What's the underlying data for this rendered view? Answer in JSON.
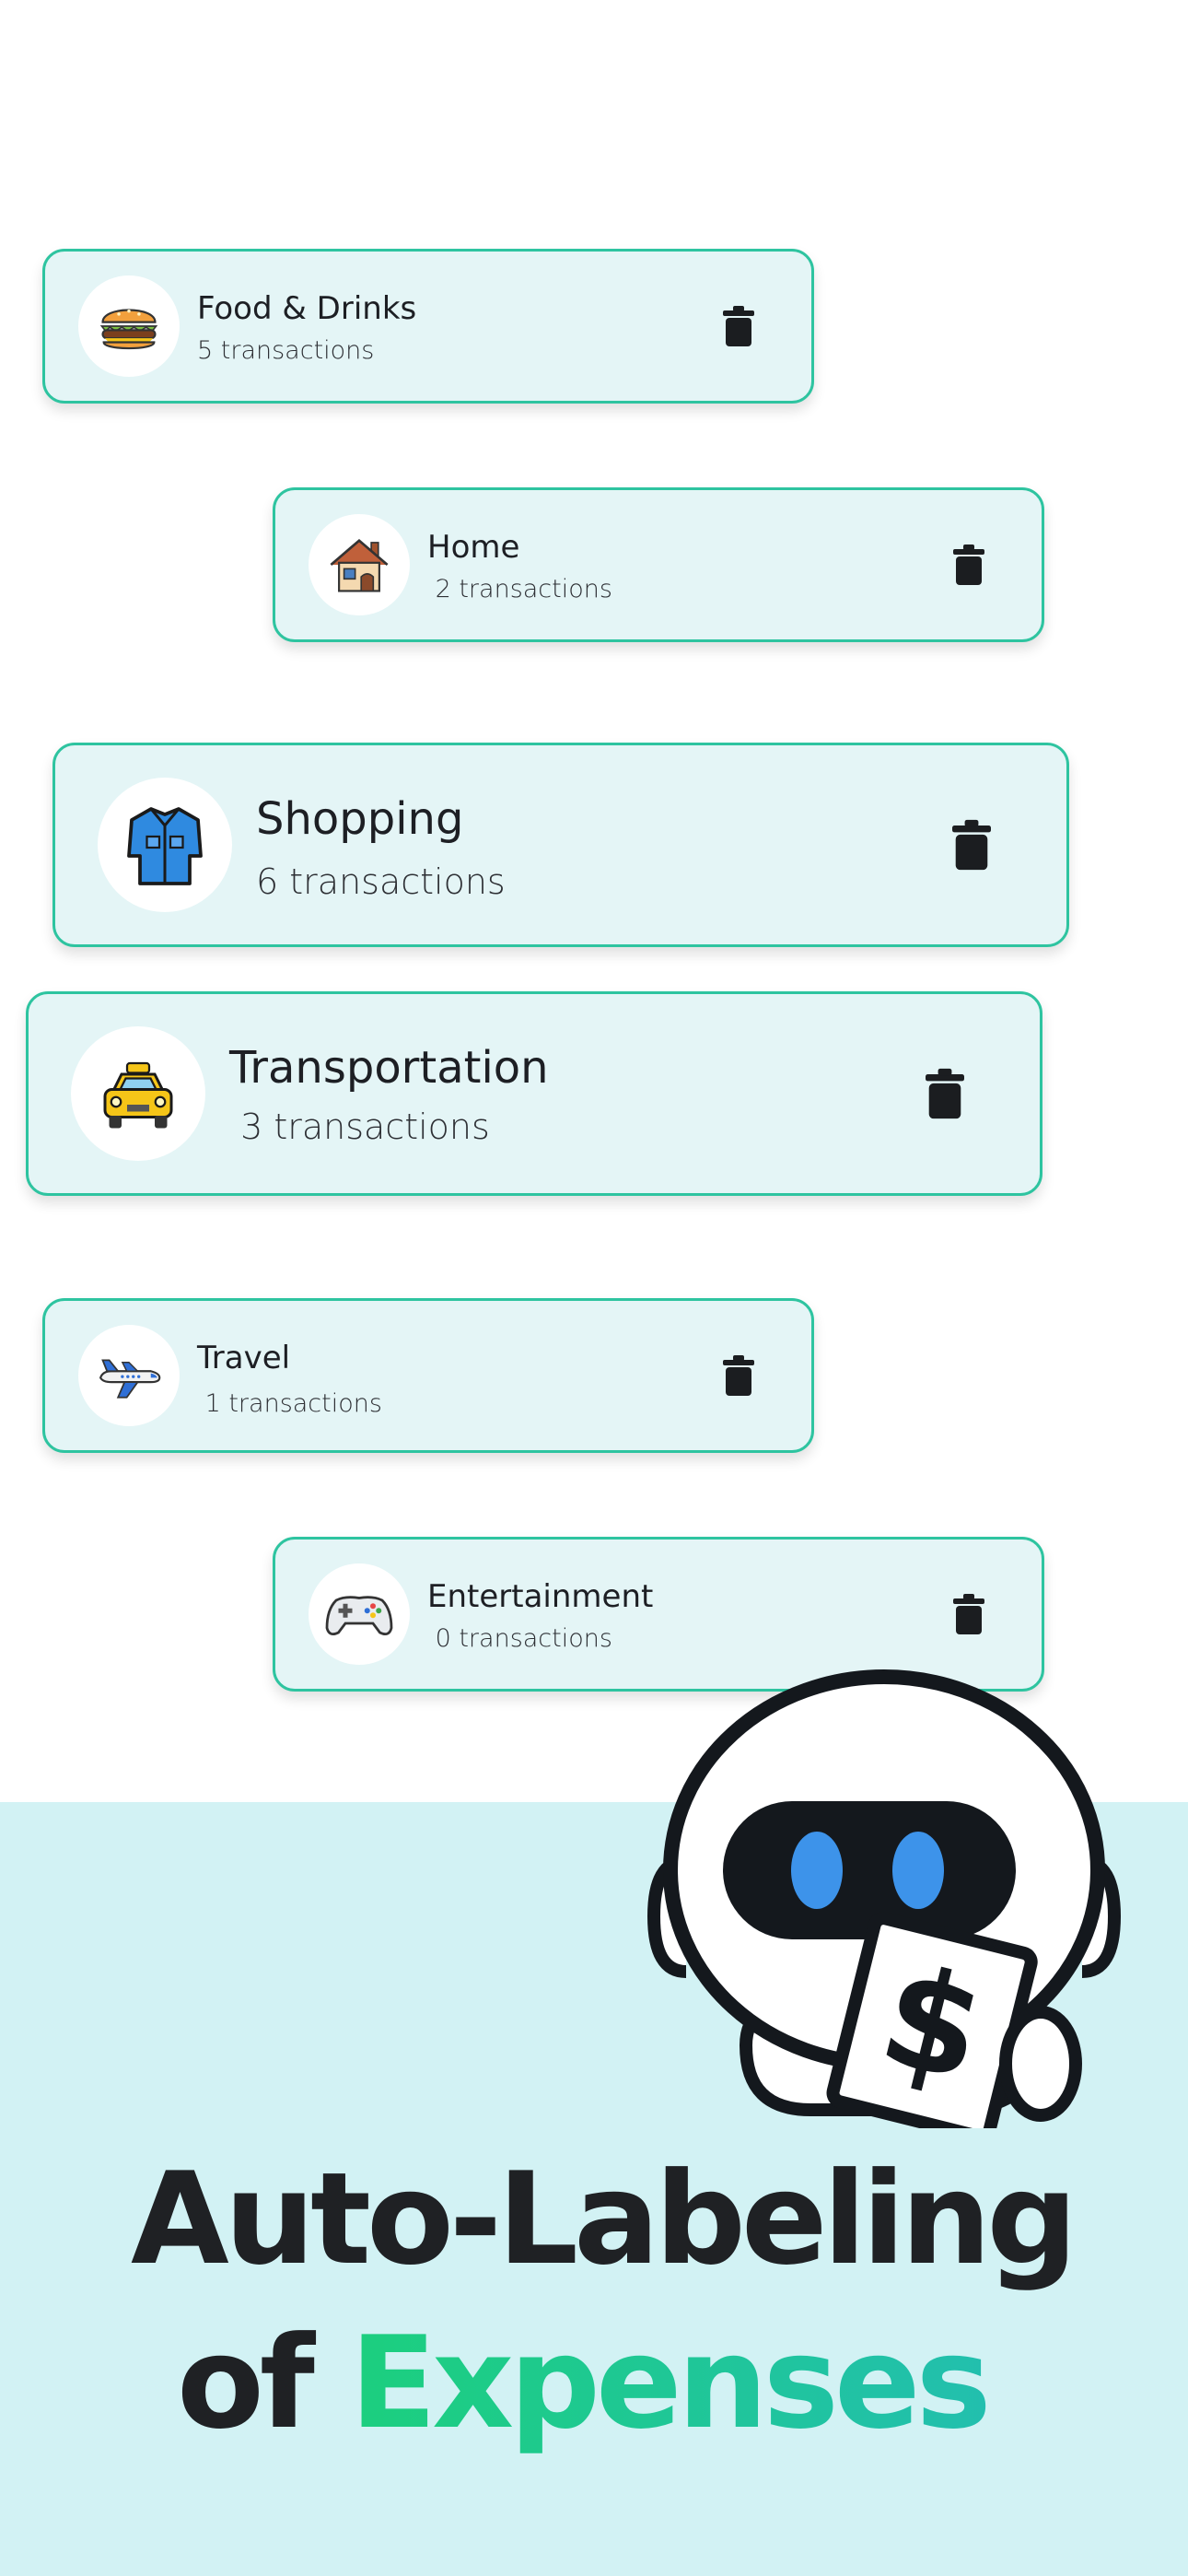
{
  "categories": [
    {
      "name": "Food & Drinks",
      "count": "5 transactions",
      "icon": "burger-icon"
    },
    {
      "name": "Home",
      "count": " 2 transactions",
      "icon": "house-icon"
    },
    {
      "name": "Shopping",
      "count": "6 transactions",
      "icon": "shirt-icon"
    },
    {
      "name": "Transportation",
      "count": " 3 transactions",
      "icon": "taxi-icon"
    },
    {
      "name": "Travel",
      "count": " 1 transactions",
      "icon": "airplane-icon"
    },
    {
      "name": "Entertainment",
      "count": " 0 transactions",
      "icon": "gamepad-icon"
    }
  ],
  "delete_icon": "trash-icon",
  "headline": {
    "line1": "Auto-Labeling",
    "line2_prefix": "of ",
    "line2_accent": "Expenses"
  },
  "mascot": {
    "name": "robot-mascot-icon",
    "receipt_symbol": "$"
  },
  "colors": {
    "card_bg": "#e4f5f6",
    "card_border": "#2ec4a0",
    "band_bg": "#d2f2f4",
    "accent_start": "#1ccf7e",
    "accent_end": "#22bfae",
    "text": "#1f2124"
  }
}
